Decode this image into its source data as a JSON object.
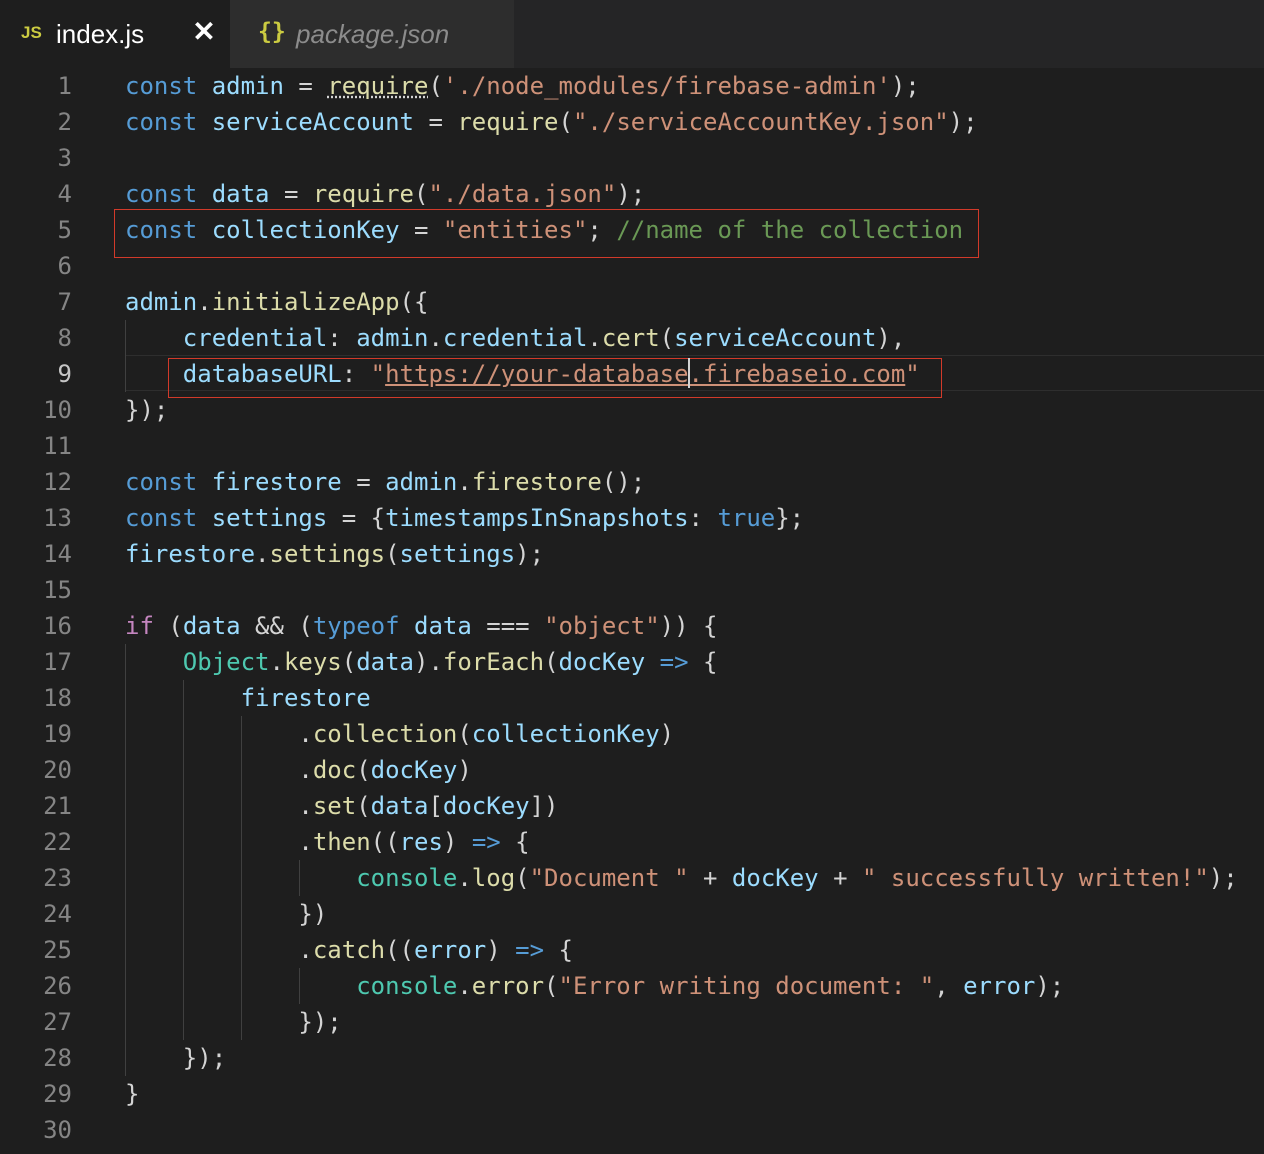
{
  "tabs": [
    {
      "icon": "JS",
      "label": "index.js",
      "close": "✕",
      "active": true
    },
    {
      "icon": "{}",
      "label": "package.json",
      "active": false
    }
  ],
  "editor": {
    "line_numbers": [
      "1",
      "2",
      "3",
      "4",
      "5",
      "6",
      "7",
      "8",
      "9",
      "10",
      "11",
      "12",
      "13",
      "14",
      "15",
      "16",
      "17",
      "18",
      "19",
      "20",
      "21",
      "22",
      "23",
      "24",
      "25",
      "26",
      "27",
      "28",
      "29",
      "30"
    ],
    "current_line": 9,
    "lines": [
      [
        {
          "t": "const ",
          "c": "kw"
        },
        {
          "t": "admin",
          "c": "var"
        },
        {
          "t": " = ",
          "c": "op"
        },
        {
          "t": "require",
          "c": "fn req"
        },
        {
          "t": "(",
          "c": "op"
        },
        {
          "t": "'./node_modules/firebase-admin'",
          "c": "str"
        },
        {
          "t": ");",
          "c": "op"
        }
      ],
      [
        {
          "t": "const ",
          "c": "kw"
        },
        {
          "t": "serviceAccount",
          "c": "var"
        },
        {
          "t": " = ",
          "c": "op"
        },
        {
          "t": "require",
          "c": "fn"
        },
        {
          "t": "(",
          "c": "op"
        },
        {
          "t": "\"./serviceAccountKey.json\"",
          "c": "str"
        },
        {
          "t": ");",
          "c": "op"
        }
      ],
      [],
      [
        {
          "t": "const ",
          "c": "kw"
        },
        {
          "t": "data",
          "c": "var"
        },
        {
          "t": " = ",
          "c": "op"
        },
        {
          "t": "require",
          "c": "fn"
        },
        {
          "t": "(",
          "c": "op"
        },
        {
          "t": "\"./data.json\"",
          "c": "str"
        },
        {
          "t": ");",
          "c": "op"
        }
      ],
      [
        {
          "t": "const ",
          "c": "kw"
        },
        {
          "t": "collectionKey",
          "c": "var"
        },
        {
          "t": " = ",
          "c": "op"
        },
        {
          "t": "\"entities\"",
          "c": "str"
        },
        {
          "t": "; ",
          "c": "op"
        },
        {
          "t": "//name of the collection",
          "c": "cmt"
        }
      ],
      [],
      [
        {
          "t": "admin",
          "c": "var"
        },
        {
          "t": ".",
          "c": "op"
        },
        {
          "t": "initializeApp",
          "c": "fn"
        },
        {
          "t": "({",
          "c": "op"
        }
      ],
      [
        {
          "t": "    ",
          "c": "op"
        },
        {
          "t": "credential",
          "c": "var"
        },
        {
          "t": ": ",
          "c": "op"
        },
        {
          "t": "admin",
          "c": "var"
        },
        {
          "t": ".",
          "c": "op"
        },
        {
          "t": "credential",
          "c": "var"
        },
        {
          "t": ".",
          "c": "op"
        },
        {
          "t": "cert",
          "c": "fn"
        },
        {
          "t": "(",
          "c": "op"
        },
        {
          "t": "serviceAccount",
          "c": "var"
        },
        {
          "t": "),",
          "c": "op"
        }
      ],
      [
        {
          "t": "    ",
          "c": "op"
        },
        {
          "t": "databaseURL",
          "c": "var"
        },
        {
          "t": ": ",
          "c": "op"
        },
        {
          "t": "\"",
          "c": "str"
        },
        {
          "t": "https://your-database.firebaseio.com",
          "c": "str url"
        },
        {
          "t": "\"",
          "c": "str"
        }
      ],
      [
        {
          "t": "});",
          "c": "op"
        }
      ],
      [],
      [
        {
          "t": "const ",
          "c": "kw"
        },
        {
          "t": "firestore",
          "c": "var"
        },
        {
          "t": " = ",
          "c": "op"
        },
        {
          "t": "admin",
          "c": "var"
        },
        {
          "t": ".",
          "c": "op"
        },
        {
          "t": "firestore",
          "c": "fn"
        },
        {
          "t": "();",
          "c": "op"
        }
      ],
      [
        {
          "t": "const ",
          "c": "kw"
        },
        {
          "t": "settings",
          "c": "var"
        },
        {
          "t": " = {",
          "c": "op"
        },
        {
          "t": "timestampsInSnapshots",
          "c": "var"
        },
        {
          "t": ": ",
          "c": "op"
        },
        {
          "t": "true",
          "c": "kw"
        },
        {
          "t": "};",
          "c": "op"
        }
      ],
      [
        {
          "t": "firestore",
          "c": "var"
        },
        {
          "t": ".",
          "c": "op"
        },
        {
          "t": "settings",
          "c": "fn"
        },
        {
          "t": "(",
          "c": "op"
        },
        {
          "t": "settings",
          "c": "var"
        },
        {
          "t": ");",
          "c": "op"
        }
      ],
      [],
      [
        {
          "t": "if",
          "c": "ctl"
        },
        {
          "t": " (",
          "c": "op"
        },
        {
          "t": "data",
          "c": "var"
        },
        {
          "t": " && (",
          "c": "op"
        },
        {
          "t": "typeof",
          "c": "kw"
        },
        {
          "t": " ",
          "c": "op"
        },
        {
          "t": "data",
          "c": "var"
        },
        {
          "t": " === ",
          "c": "op"
        },
        {
          "t": "\"object\"",
          "c": "str"
        },
        {
          "t": ")) {",
          "c": "op"
        }
      ],
      [
        {
          "t": "    ",
          "c": "op"
        },
        {
          "t": "Object",
          "c": "typ"
        },
        {
          "t": ".",
          "c": "op"
        },
        {
          "t": "keys",
          "c": "fn"
        },
        {
          "t": "(",
          "c": "op"
        },
        {
          "t": "data",
          "c": "var"
        },
        {
          "t": ").",
          "c": "op"
        },
        {
          "t": "forEach",
          "c": "fn"
        },
        {
          "t": "(",
          "c": "op"
        },
        {
          "t": "docKey",
          "c": "var"
        },
        {
          "t": " ",
          "c": "op"
        },
        {
          "t": "=>",
          "c": "kw"
        },
        {
          "t": " {",
          "c": "op"
        }
      ],
      [
        {
          "t": "        ",
          "c": "op"
        },
        {
          "t": "firestore",
          "c": "var"
        }
      ],
      [
        {
          "t": "            .",
          "c": "op"
        },
        {
          "t": "collection",
          "c": "fn"
        },
        {
          "t": "(",
          "c": "op"
        },
        {
          "t": "collectionKey",
          "c": "var"
        },
        {
          "t": ")",
          "c": "op"
        }
      ],
      [
        {
          "t": "            .",
          "c": "op"
        },
        {
          "t": "doc",
          "c": "fn"
        },
        {
          "t": "(",
          "c": "op"
        },
        {
          "t": "docKey",
          "c": "var"
        },
        {
          "t": ")",
          "c": "op"
        }
      ],
      [
        {
          "t": "            .",
          "c": "op"
        },
        {
          "t": "set",
          "c": "fn"
        },
        {
          "t": "(",
          "c": "op"
        },
        {
          "t": "data",
          "c": "var"
        },
        {
          "t": "[",
          "c": "op"
        },
        {
          "t": "docKey",
          "c": "var"
        },
        {
          "t": "])",
          "c": "op"
        }
      ],
      [
        {
          "t": "            .",
          "c": "op"
        },
        {
          "t": "then",
          "c": "fn"
        },
        {
          "t": "((",
          "c": "op"
        },
        {
          "t": "res",
          "c": "var"
        },
        {
          "t": ") ",
          "c": "op"
        },
        {
          "t": "=>",
          "c": "kw"
        },
        {
          "t": " {",
          "c": "op"
        }
      ],
      [
        {
          "t": "                ",
          "c": "op"
        },
        {
          "t": "console",
          "c": "typ"
        },
        {
          "t": ".",
          "c": "op"
        },
        {
          "t": "log",
          "c": "fn"
        },
        {
          "t": "(",
          "c": "op"
        },
        {
          "t": "\"Document \"",
          "c": "str"
        },
        {
          "t": " + ",
          "c": "op"
        },
        {
          "t": "docKey",
          "c": "var"
        },
        {
          "t": " + ",
          "c": "op"
        },
        {
          "t": "\" successfully written!\"",
          "c": "str"
        },
        {
          "t": ");",
          "c": "op"
        }
      ],
      [
        {
          "t": "            })",
          "c": "op"
        }
      ],
      [
        {
          "t": "            .",
          "c": "op"
        },
        {
          "t": "catch",
          "c": "fn"
        },
        {
          "t": "((",
          "c": "op"
        },
        {
          "t": "error",
          "c": "var"
        },
        {
          "t": ") ",
          "c": "op"
        },
        {
          "t": "=>",
          "c": "kw"
        },
        {
          "t": " {",
          "c": "op"
        }
      ],
      [
        {
          "t": "                ",
          "c": "op"
        },
        {
          "t": "console",
          "c": "typ"
        },
        {
          "t": ".",
          "c": "op"
        },
        {
          "t": "error",
          "c": "fn"
        },
        {
          "t": "(",
          "c": "op"
        },
        {
          "t": "\"Error writing document: \"",
          "c": "str"
        },
        {
          "t": ", ",
          "c": "op"
        },
        {
          "t": "error",
          "c": "var"
        },
        {
          "t": ");",
          "c": "op"
        }
      ],
      [
        {
          "t": "            });",
          "c": "op"
        }
      ],
      [
        {
          "t": "    });",
          "c": "op"
        }
      ],
      [
        {
          "t": "}",
          "c": "op"
        }
      ],
      []
    ]
  }
}
